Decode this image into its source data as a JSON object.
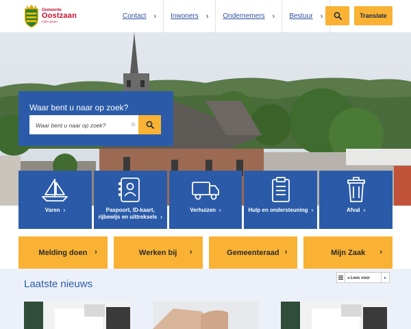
{
  "header": {
    "logo": {
      "small": "Gemeente",
      "name": "Oostzaan",
      "tagline": "Kalm groen"
    },
    "nav": [
      {
        "label": "Contact"
      },
      {
        "label": "Inwoners"
      },
      {
        "label": "Ondernemers"
      },
      {
        "label": "Bestuur"
      }
    ],
    "translate_label": "Translate"
  },
  "search": {
    "title": "Waar bent u naar op zoek?",
    "placeholder": "Waar bent u naar op zoek?"
  },
  "tiles": [
    {
      "label": "Varen",
      "icon": "sailboat-icon"
    },
    {
      "label": "Paspoort, ID-kaart, rijbewijs en uittreksels",
      "icon": "id-card-icon"
    },
    {
      "label": "Verhuizen",
      "icon": "truck-icon"
    },
    {
      "label": "Hulp en ondersteuning",
      "icon": "clipboard-icon"
    },
    {
      "label": "Afval",
      "icon": "trash-icon"
    }
  ],
  "quick_links": [
    {
      "label": "Melding doen"
    },
    {
      "label": "Werken bij"
    },
    {
      "label": "Gemeenteraad"
    },
    {
      "label": "Mijn Zaak"
    }
  ],
  "news": {
    "title": "Laatste nieuws",
    "reader_label": "Lees voor"
  },
  "colors": {
    "primary_blue": "#2b5ba8",
    "accent_yellow": "#f9b233",
    "news_bg": "#ecf1f9"
  }
}
